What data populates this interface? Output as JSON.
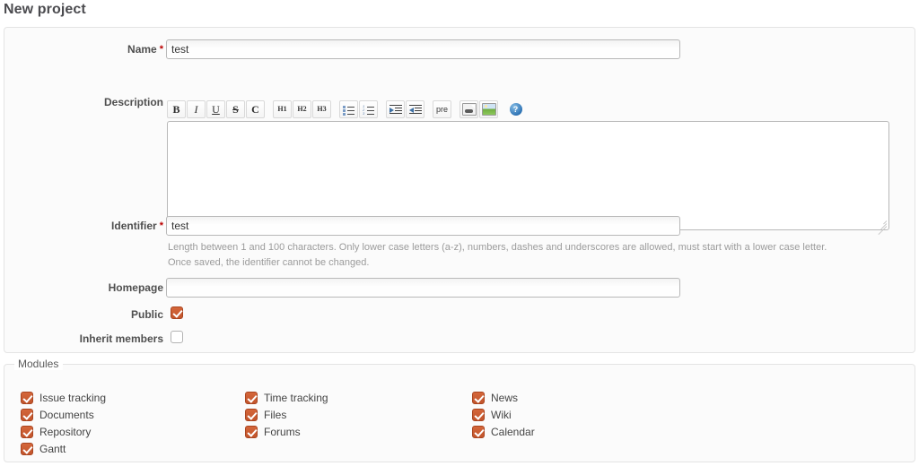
{
  "page": {
    "title": "New project"
  },
  "form": {
    "name": {
      "label": "Name",
      "required_mark": "*",
      "value": "test",
      "placeholder": ""
    },
    "description": {
      "label": "Description",
      "value": "",
      "placeholder": ""
    },
    "identifier": {
      "label": "Identifier",
      "required_mark": "*",
      "value": "test",
      "placeholder": "",
      "hint_line1": "Length between 1 and 100 characters. Only lower case letters (a-z), numbers, dashes and underscores are allowed, must start with a lower case letter.",
      "hint_line2": "Once saved, the identifier cannot be changed."
    },
    "homepage": {
      "label": "Homepage",
      "value": "",
      "placeholder": ""
    },
    "public": {
      "label": "Public",
      "checked": true
    },
    "inherit_members": {
      "label": "Inherit members",
      "checked": false
    }
  },
  "toolbar": {
    "buttons": [
      {
        "name": "bold-button",
        "label": "B",
        "kind": "b"
      },
      {
        "name": "italic-button",
        "label": "I",
        "kind": "i"
      },
      {
        "name": "underline-button",
        "label": "U",
        "kind": "u"
      },
      {
        "name": "strikethrough-button",
        "label": "S",
        "kind": "s"
      },
      {
        "name": "code-button",
        "label": "C",
        "kind": "c"
      },
      {
        "name": "heading-1-button",
        "label": "H1",
        "kind": "h"
      },
      {
        "name": "heading-2-button",
        "label": "H2",
        "kind": "h"
      },
      {
        "name": "heading-3-button",
        "label": "H3",
        "kind": "h"
      },
      {
        "name": "unordered-list-button",
        "label": "",
        "kind": "ul"
      },
      {
        "name": "ordered-list-button",
        "label": "",
        "kind": "ol"
      },
      {
        "name": "indent-button",
        "label": "",
        "kind": "indent"
      },
      {
        "name": "outdent-button",
        "label": "",
        "kind": "outdent"
      },
      {
        "name": "preformatted-button",
        "label": "pre",
        "kind": "pre"
      },
      {
        "name": "link-icon",
        "label": "",
        "kind": "link"
      },
      {
        "name": "image-icon",
        "label": "",
        "kind": "image"
      },
      {
        "name": "help-icon",
        "label": "?",
        "kind": "help"
      }
    ]
  },
  "modules": {
    "legend": "Modules",
    "columns": [
      [
        {
          "label": "Issue tracking",
          "checked": true
        },
        {
          "label": "Documents",
          "checked": true
        },
        {
          "label": "Repository",
          "checked": true
        },
        {
          "label": "Gantt",
          "checked": true
        }
      ],
      [
        {
          "label": "Time tracking",
          "checked": true
        },
        {
          "label": "Files",
          "checked": true
        },
        {
          "label": "Forums",
          "checked": true
        }
      ],
      [
        {
          "label": "News",
          "checked": true
        },
        {
          "label": "Wiki",
          "checked": true
        },
        {
          "label": "Calendar",
          "checked": true
        }
      ]
    ]
  },
  "colors": {
    "accent": "#c2552c",
    "required": "#bb0000",
    "text": "#484848",
    "hint": "#9b9b9b",
    "box_bg": "#fbfbfb",
    "box_border": "#e4e4e4"
  }
}
